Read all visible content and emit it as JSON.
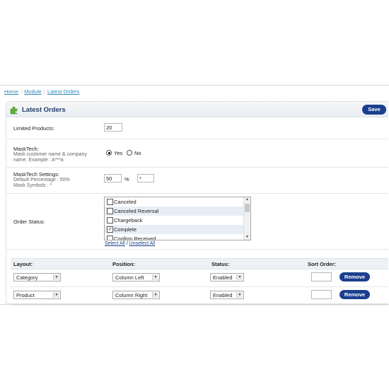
{
  "breadcrumb": {
    "items": [
      "Home",
      "Module",
      "Latest Orders"
    ],
    "separator": "::"
  },
  "header": {
    "title": "Latest Orders",
    "save_label": "Save",
    "icon": "puzzle-icon"
  },
  "form": {
    "limited_products": {
      "label": "Limited Products:",
      "value": "20"
    },
    "masktech": {
      "label": "MaskTech:",
      "description_line1": "Mask customer name & company",
      "description_line2": "name. Example : A***a",
      "yes_label": "Yes",
      "no_label": "No",
      "selected": "Yes"
    },
    "masktech_settings": {
      "label": "MaskTech Settings:",
      "default_percentage_text": "Default Percentage : 50%",
      "mask_symbols_text": "Mask Symbols : *",
      "percentage_value": "50",
      "percent_sign": "%",
      "symbol_value": "*"
    },
    "order_status": {
      "label": "Order Status:",
      "options": [
        {
          "label": "Canceled",
          "checked": false
        },
        {
          "label": "Canceled Reversal",
          "checked": false
        },
        {
          "label": "Chargeback",
          "checked": false
        },
        {
          "label": "Complete",
          "checked": true
        },
        {
          "label": "Confirm Received",
          "checked": false
        }
      ],
      "select_all": "Select All",
      "link_separator": "/",
      "unselect_all": "Unselect All"
    }
  },
  "modules": {
    "headers": {
      "layout": "Layout:",
      "position": "Position:",
      "status": "Status:",
      "sort_order": "Sort Order:"
    },
    "rows": [
      {
        "layout": "Category",
        "position": "Column Left",
        "status": "Enabled",
        "sort_order": "",
        "remove_label": "Remove"
      },
      {
        "layout": "Product",
        "position": "Column Right",
        "status": "Enabled",
        "sort_order": "",
        "remove_label": "Remove"
      }
    ]
  },
  "colors": {
    "accent": "#1b3f8f",
    "title": "#213e6b",
    "link": "#3388bb",
    "icon_green": "#5fb03a"
  }
}
